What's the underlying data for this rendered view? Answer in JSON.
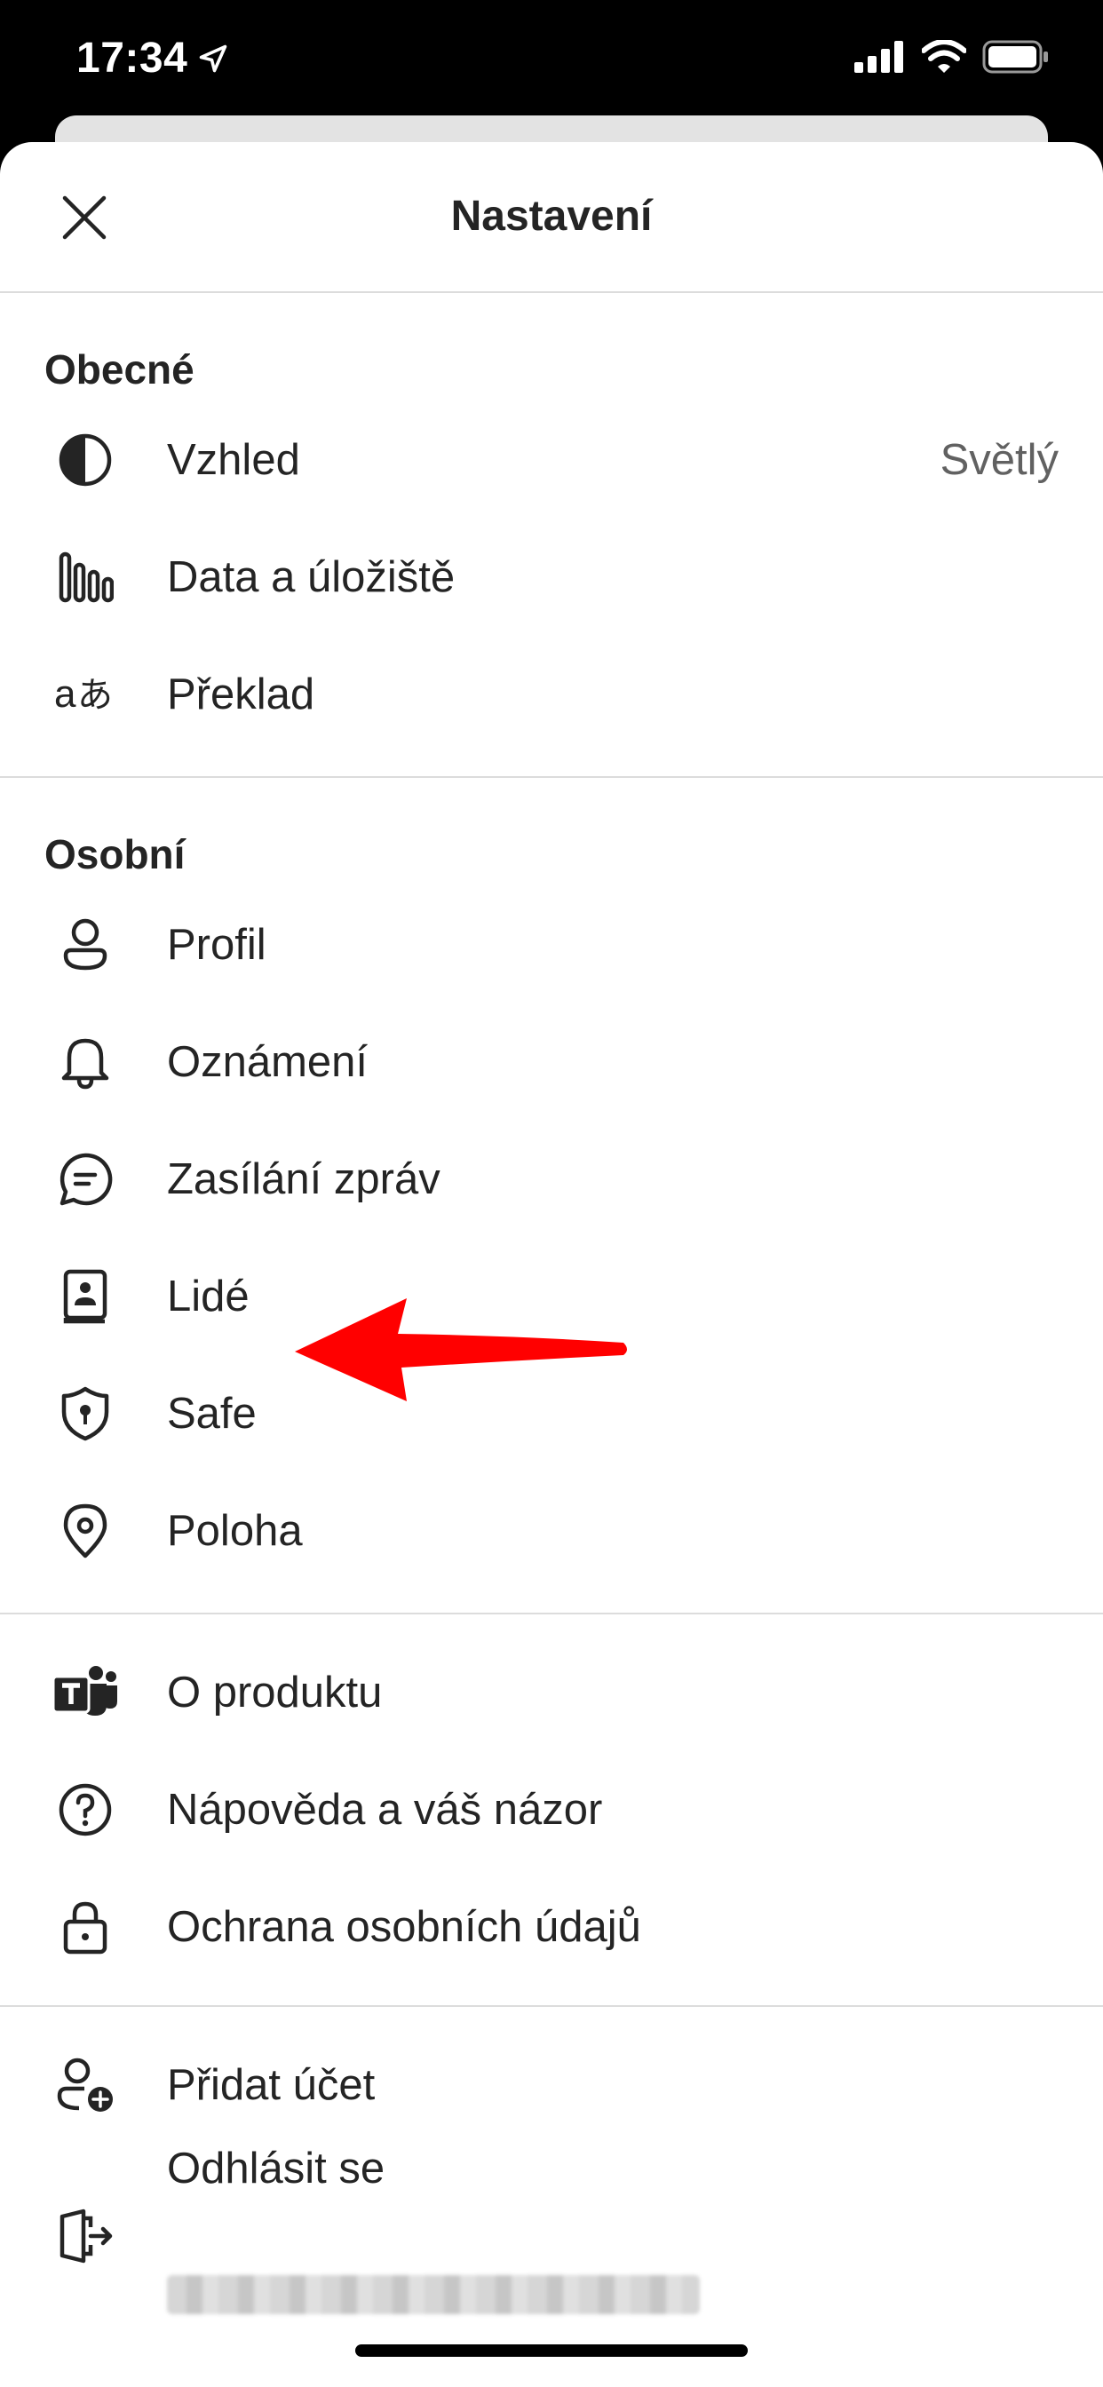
{
  "status_bar": {
    "time": "17:34"
  },
  "header": {
    "title": "Nastavení"
  },
  "general": {
    "title": "Obecné",
    "items": [
      {
        "label": "Vzhled",
        "value": "Světlý"
      },
      {
        "label": "Data a úložiště"
      },
      {
        "label": "Překlad"
      }
    ]
  },
  "personal": {
    "title": "Osobní",
    "items": [
      {
        "label": "Profil"
      },
      {
        "label": "Oznámení"
      },
      {
        "label": "Zasílání zpráv"
      },
      {
        "label": "Lidé"
      },
      {
        "label": "Safe"
      },
      {
        "label": "Poloha"
      }
    ]
  },
  "about": {
    "items": [
      {
        "label": "O produktu"
      },
      {
        "label": "Nápověda a váš názor"
      },
      {
        "label": "Ochrana osobních údajů"
      }
    ]
  },
  "account": {
    "items": [
      {
        "label": "Přidat účet"
      },
      {
        "label": "Odhlásit se"
      }
    ]
  },
  "colors": {
    "annotation_arrow": "#ff0000",
    "text": "#242424",
    "secondary_text": "#616161"
  },
  "icons": {
    "appearance": "contrast-icon",
    "data": "data-bars-icon",
    "translate": "translate-icon",
    "profile": "person-icon",
    "notifications": "bell-icon",
    "messaging": "chat-icon",
    "people": "contact-book-icon",
    "safe": "shield-icon",
    "location": "location-pin-icon",
    "about": "teams-logo-icon",
    "help": "question-icon",
    "privacy": "lock-icon",
    "add_account": "person-add-icon",
    "sign_out": "sign-out-icon"
  }
}
